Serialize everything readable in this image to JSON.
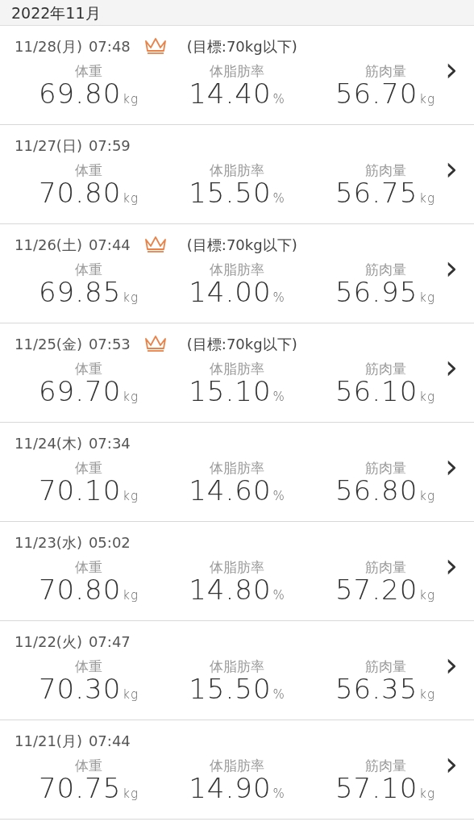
{
  "month_header": "2022年11月",
  "records": [
    {
      "date": "11/28(月)",
      "time": "07:48",
      "crown": true,
      "goal": "(目標:70kg以下)",
      "metrics": [
        {
          "label": "体重",
          "value": "69.80",
          "unit": "kg"
        },
        {
          "label": "体脂肪率",
          "value": "14.40",
          "unit": "%"
        },
        {
          "label": "筋肉量",
          "value": "56.70",
          "unit": "kg"
        }
      ],
      "chevron": "›"
    },
    {
      "date": "11/27(日)",
      "time": "07:59",
      "crown": false,
      "metrics": [
        {
          "label": "体重",
          "value": "70.80",
          "unit": "kg"
        },
        {
          "label": "体脂肪率",
          "value": "15.50",
          "unit": "%"
        },
        {
          "label": "筋肉量",
          "value": "56.75",
          "unit": "kg"
        }
      ],
      "chevron": "›"
    },
    {
      "date": "11/26(土)",
      "time": "07:44",
      "crown": true,
      "goal": "(目標:70kg以下)",
      "metrics": [
        {
          "label": "体重",
          "value": "69.85",
          "unit": "kg"
        },
        {
          "label": "体脂肪率",
          "value": "14.00",
          "unit": "%"
        },
        {
          "label": "筋肉量",
          "value": "56.95",
          "unit": "kg"
        }
      ],
      "chevron": "›"
    },
    {
      "date": "11/25(金)",
      "time": "07:53",
      "crown": true,
      "goal": "(目標:70kg以下)",
      "metrics": [
        {
          "label": "体重",
          "value": "69.70",
          "unit": "kg"
        },
        {
          "label": "体脂肪率",
          "value": "15.10",
          "unit": "%"
        },
        {
          "label": "筋肉量",
          "value": "56.10",
          "unit": "kg"
        }
      ],
      "chevron": "›"
    },
    {
      "date": "11/24(木)",
      "time": "07:34",
      "crown": false,
      "metrics": [
        {
          "label": "体重",
          "value": "70.10",
          "unit": "kg"
        },
        {
          "label": "体脂肪率",
          "value": "14.60",
          "unit": "%"
        },
        {
          "label": "筋肉量",
          "value": "56.80",
          "unit": "kg"
        }
      ],
      "chevron": "›"
    },
    {
      "date": "11/23(水)",
      "time": "05:02",
      "crown": false,
      "metrics": [
        {
          "label": "体重",
          "value": "70.80",
          "unit": "kg"
        },
        {
          "label": "体脂肪率",
          "value": "14.80",
          "unit": "%"
        },
        {
          "label": "筋肉量",
          "value": "57.20",
          "unit": "kg"
        }
      ],
      "chevron": "›"
    },
    {
      "date": "11/22(火)",
      "time": "07:47",
      "crown": false,
      "metrics": [
        {
          "label": "体重",
          "value": "70.30",
          "unit": "kg"
        },
        {
          "label": "体脂肪率",
          "value": "15.50",
          "unit": "%"
        },
        {
          "label": "筋肉量",
          "value": "56.35",
          "unit": "kg"
        }
      ],
      "chevron": "›"
    },
    {
      "date": "11/21(月)",
      "time": "07:44",
      "crown": false,
      "metrics": [
        {
          "label": "体重",
          "value": "70.75",
          "unit": "kg"
        },
        {
          "label": "体脂肪率",
          "value": "14.90",
          "unit": "%"
        },
        {
          "label": "筋肉量",
          "value": "57.10",
          "unit": "kg"
        }
      ],
      "chevron": "›"
    }
  ]
}
